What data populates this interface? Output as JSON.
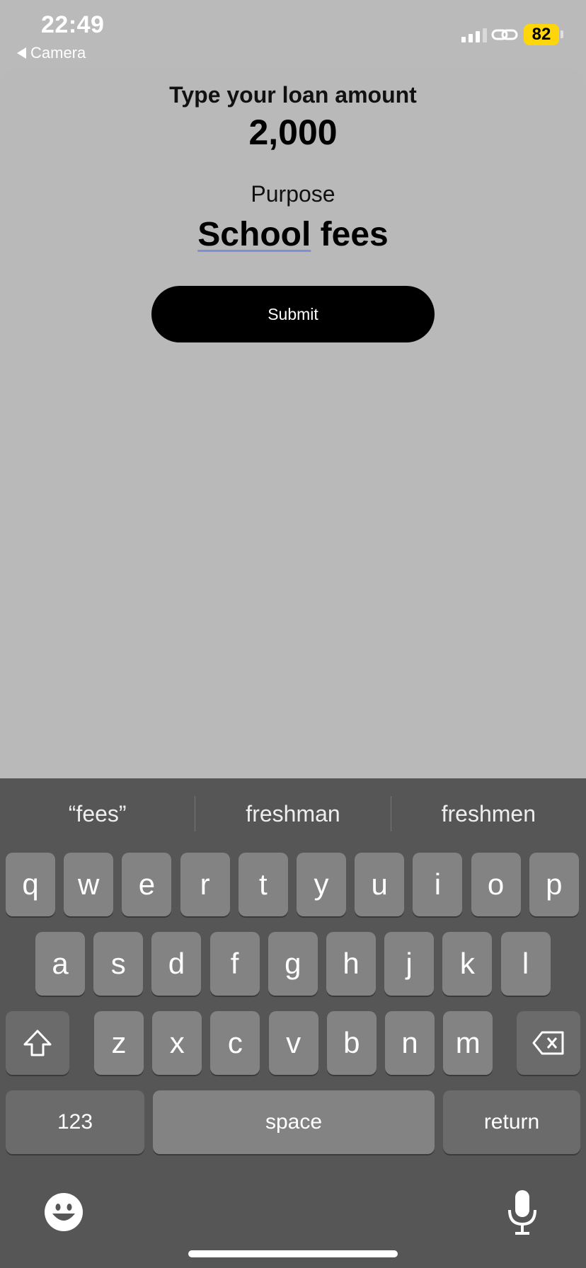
{
  "status_bar": {
    "time": "22:49",
    "back_label": "Camera",
    "battery": "82",
    "battery_color": "#ffd60a"
  },
  "form": {
    "loan_label": "Type your loan amount",
    "loan_amount": "2,000",
    "purpose_label": "Purpose",
    "purpose_word1": "School",
    "purpose_word2": " fees",
    "submit_label": "Submit"
  },
  "keyboard": {
    "suggestions": [
      "“fees”",
      "freshman",
      "freshmen"
    ],
    "row1": [
      "q",
      "w",
      "e",
      "r",
      "t",
      "y",
      "u",
      "i",
      "o",
      "p"
    ],
    "row2": [
      "a",
      "s",
      "d",
      "f",
      "g",
      "h",
      "j",
      "k",
      "l"
    ],
    "row3": [
      "z",
      "x",
      "c",
      "v",
      "b",
      "n",
      "m"
    ],
    "numbers_label": "123",
    "space_label": "space",
    "return_label": "return",
    "icons": [
      "shift-icon",
      "backspace-icon",
      "emoji-icon",
      "microphone-icon"
    ]
  }
}
